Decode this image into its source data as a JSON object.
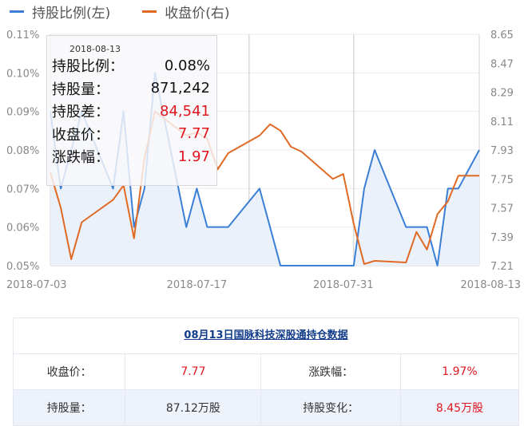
{
  "legend": {
    "series_left": "持股比例(左)",
    "series_right": "收盘价(右)"
  },
  "colors": {
    "holding": "#3a7fd5",
    "price": "#e06a24",
    "area": "#eaf1fb",
    "red": "#e0161f"
  },
  "chart_data": {
    "type": "line",
    "x_ticks": [
      "2018-07-03",
      "2018-07-17",
      "2018-07-31",
      "2018-08-13"
    ],
    "x_range": [
      "2018-07-03",
      "2018-08-13"
    ],
    "left_axis": {
      "ticks": [
        "0.11%",
        "0.10%",
        "0.09%",
        "0.08%",
        "0.07%",
        "0.06%",
        "0.05%"
      ],
      "range": [
        0.05,
        0.11
      ]
    },
    "right_axis": {
      "ticks": [
        "8.65",
        "8.47",
        "8.29",
        "8.11",
        "7.93",
        "7.75",
        "7.57",
        "7.39",
        "7.21"
      ],
      "range": [
        7.21,
        8.65
      ]
    },
    "vertical_lines": [
      "2018-07-22",
      "2018-08-01"
    ],
    "series": [
      {
        "name": "持股比例(左)",
        "axis": "left",
        "points": [
          [
            "2018-07-03",
            0.09
          ],
          [
            "2018-07-04",
            0.07
          ],
          [
            "2018-07-05",
            0.08
          ],
          [
            "2018-07-06",
            0.09
          ],
          [
            "2018-07-09",
            0.07
          ],
          [
            "2018-07-10",
            0.09
          ],
          [
            "2018-07-11",
            0.06
          ],
          [
            "2018-07-12",
            0.07
          ],
          [
            "2018-07-13",
            0.1
          ],
          [
            "2018-07-16",
            0.06
          ],
          [
            "2018-07-17",
            0.07
          ],
          [
            "2018-07-18",
            0.06
          ],
          [
            "2018-07-19",
            0.06
          ],
          [
            "2018-07-20",
            0.06
          ],
          [
            "2018-07-23",
            0.07
          ],
          [
            "2018-07-24",
            0.06
          ],
          [
            "2018-07-25",
            0.05
          ],
          [
            "2018-07-26",
            0.05
          ],
          [
            "2018-07-27",
            0.05
          ],
          [
            "2018-07-30",
            0.05
          ],
          [
            "2018-07-31",
            0.05
          ],
          [
            "2018-08-01",
            0.05
          ],
          [
            "2018-08-02",
            0.07
          ],
          [
            "2018-08-03",
            0.08
          ],
          [
            "2018-08-06",
            0.06
          ],
          [
            "2018-08-07",
            0.06
          ],
          [
            "2018-08-08",
            0.06
          ],
          [
            "2018-08-09",
            0.05
          ],
          [
            "2018-08-10",
            0.07
          ],
          [
            "2018-08-11",
            0.07
          ],
          [
            "2018-08-13",
            0.08
          ]
        ]
      },
      {
        "name": "收盘价(右)",
        "axis": "right",
        "points": [
          [
            "2018-07-03",
            7.79
          ],
          [
            "2018-07-04",
            7.57
          ],
          [
            "2018-07-05",
            7.25
          ],
          [
            "2018-07-06",
            7.48
          ],
          [
            "2018-07-09",
            7.62
          ],
          [
            "2018-07-10",
            7.71
          ],
          [
            "2018-07-11",
            7.38
          ],
          [
            "2018-07-12",
            7.88
          ],
          [
            "2018-07-13",
            8.17
          ],
          [
            "2018-07-16",
            8.02
          ],
          [
            "2018-07-17",
            8.04
          ],
          [
            "2018-07-18",
            8.0
          ],
          [
            "2018-07-19",
            7.81
          ],
          [
            "2018-07-20",
            7.91
          ],
          [
            "2018-07-23",
            8.02
          ],
          [
            "2018-07-24",
            8.09
          ],
          [
            "2018-07-25",
            8.05
          ],
          [
            "2018-07-26",
            7.95
          ],
          [
            "2018-07-27",
            7.92
          ],
          [
            "2018-07-30",
            7.75
          ],
          [
            "2018-07-31",
            7.78
          ],
          [
            "2018-08-01",
            7.47
          ],
          [
            "2018-08-02",
            7.22
          ],
          [
            "2018-08-03",
            7.24
          ],
          [
            "2018-08-06",
            7.23
          ],
          [
            "2018-08-07",
            7.42
          ],
          [
            "2018-08-08",
            7.31
          ],
          [
            "2018-08-09",
            7.53
          ],
          [
            "2018-08-10",
            7.61
          ],
          [
            "2018-08-11",
            7.77
          ],
          [
            "2018-08-13",
            7.77
          ]
        ]
      }
    ]
  },
  "tooltip": {
    "date": "2018-08-13",
    "rows": [
      {
        "label": "持股比例：",
        "value": "0.08%",
        "red": false
      },
      {
        "label": "持股量：",
        "value": "871,242",
        "red": false
      },
      {
        "label": "持股差：",
        "value": "84,541",
        "red": true
      },
      {
        "label": "收盘价：",
        "value": "7.77",
        "red": true
      },
      {
        "label": "涨跌幅：",
        "value": "1.97",
        "red": true
      }
    ]
  },
  "table": {
    "title": "08月13日国脉科技深股通持仓数据",
    "rows": [
      {
        "label1": "收盘价：",
        "value1": "7.77",
        "label2": "涨跌幅：",
        "value2": "1.97%"
      },
      {
        "label1": "持股量：",
        "value1": "87.12万股",
        "label2": "持股变化：",
        "value2": "8.45万股"
      }
    ]
  }
}
